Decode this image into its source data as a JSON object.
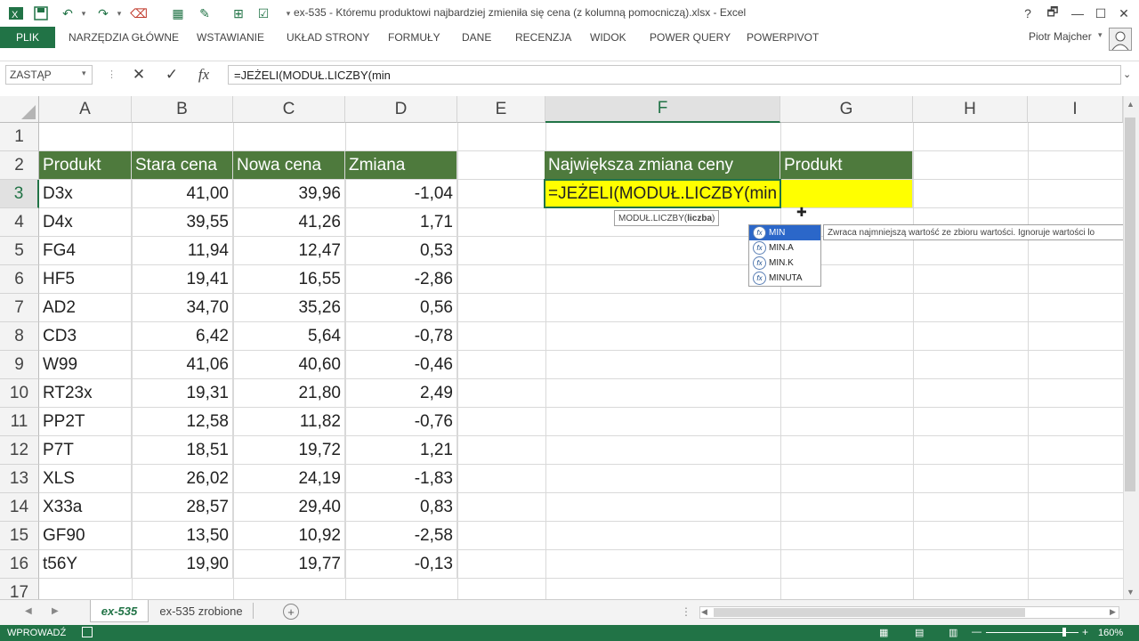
{
  "titlebar": {
    "title": "ex-535 - Któremu produktowi najbardziej zmieniła się cena (z kolumną pomocniczą).xlsx - Excel",
    "help": "?",
    "restore": "🗗",
    "minimize": "—",
    "maximize": "☐",
    "close": "✕"
  },
  "ribbon": {
    "file": "PLIK",
    "tabs": [
      "NARZĘDZIA GŁÓWNE",
      "WSTAWIANIE",
      "UKŁAD STRONY",
      "FORMUŁY",
      "DANE",
      "RECENZJA",
      "WIDOK",
      "POWER QUERY",
      "POWERPIVOT"
    ],
    "user": "Piotr Majcher"
  },
  "formula_bar": {
    "name_box": "ZASTĄP",
    "cancel": "✕",
    "enter": "✓",
    "fx": "fx",
    "formula": "=JEŻELI(MODUŁ.LICZBY(min"
  },
  "columns": [
    "A",
    "B",
    "C",
    "D",
    "E",
    "F",
    "G",
    "H",
    "I"
  ],
  "rows": [
    "1",
    "2",
    "3",
    "4",
    "5",
    "6",
    "7",
    "8",
    "9",
    "10",
    "11",
    "12",
    "13",
    "14",
    "15",
    "16",
    "17"
  ],
  "table": {
    "headers": [
      "Produkt",
      "Stara cena",
      "Nowa cena",
      "Zmiana"
    ],
    "rows": [
      [
        "D3x",
        "41,00",
        "39,96",
        "-1,04"
      ],
      [
        "D4x",
        "39,55",
        "41,26",
        "1,71"
      ],
      [
        "FG4",
        "11,94",
        "12,47",
        "0,53"
      ],
      [
        "HF5",
        "19,41",
        "16,55",
        "-2,86"
      ],
      [
        "AD2",
        "34,70",
        "35,26",
        "0,56"
      ],
      [
        "CD3",
        "6,42",
        "5,64",
        "-0,78"
      ],
      [
        "W99",
        "41,06",
        "40,60",
        "-0,46"
      ],
      [
        "RT23x",
        "19,31",
        "21,80",
        "2,49"
      ],
      [
        "PP2T",
        "12,58",
        "11,82",
        "-0,76"
      ],
      [
        "P7T",
        "18,51",
        "19,72",
        "1,21"
      ],
      [
        "XLS",
        "26,02",
        "24,19",
        "-1,83"
      ],
      [
        "X33a",
        "28,57",
        "29,40",
        "0,83"
      ],
      [
        "GF90",
        "13,50",
        "10,92",
        "-2,58"
      ],
      [
        "t56Y",
        "19,90",
        "19,77",
        "-0,13"
      ]
    ]
  },
  "result": {
    "header_f": "Największa zmiana ceny",
    "header_g": "Produkt",
    "active_value": "=JEŻELI(MODUŁ.LICZBY(min"
  },
  "autocomplete": {
    "arg_tip_fn": "MODUŁ.LICZBY(",
    "arg_tip_arg": "liczba",
    "arg_tip_close": ")",
    "items": [
      "MIN",
      "MIN.A",
      "MIN.K",
      "MINUTA"
    ],
    "selected_index": 0,
    "description": "Zwraca najmniejszą wartość ze zbioru wartości. Ignoruje wartości lo"
  },
  "sheets": {
    "tabs": [
      "ex-535",
      "ex-535 zrobione"
    ],
    "active_index": 0,
    "add": "+",
    "nav_prev": "◀",
    "nav_next": "▶",
    "more": "..."
  },
  "status": {
    "mode": "WPROWADŹ",
    "zoom": "160%"
  },
  "colors": {
    "accent": "#217346",
    "table_header": "#4e7a3d",
    "highlight": "#ffff00"
  }
}
